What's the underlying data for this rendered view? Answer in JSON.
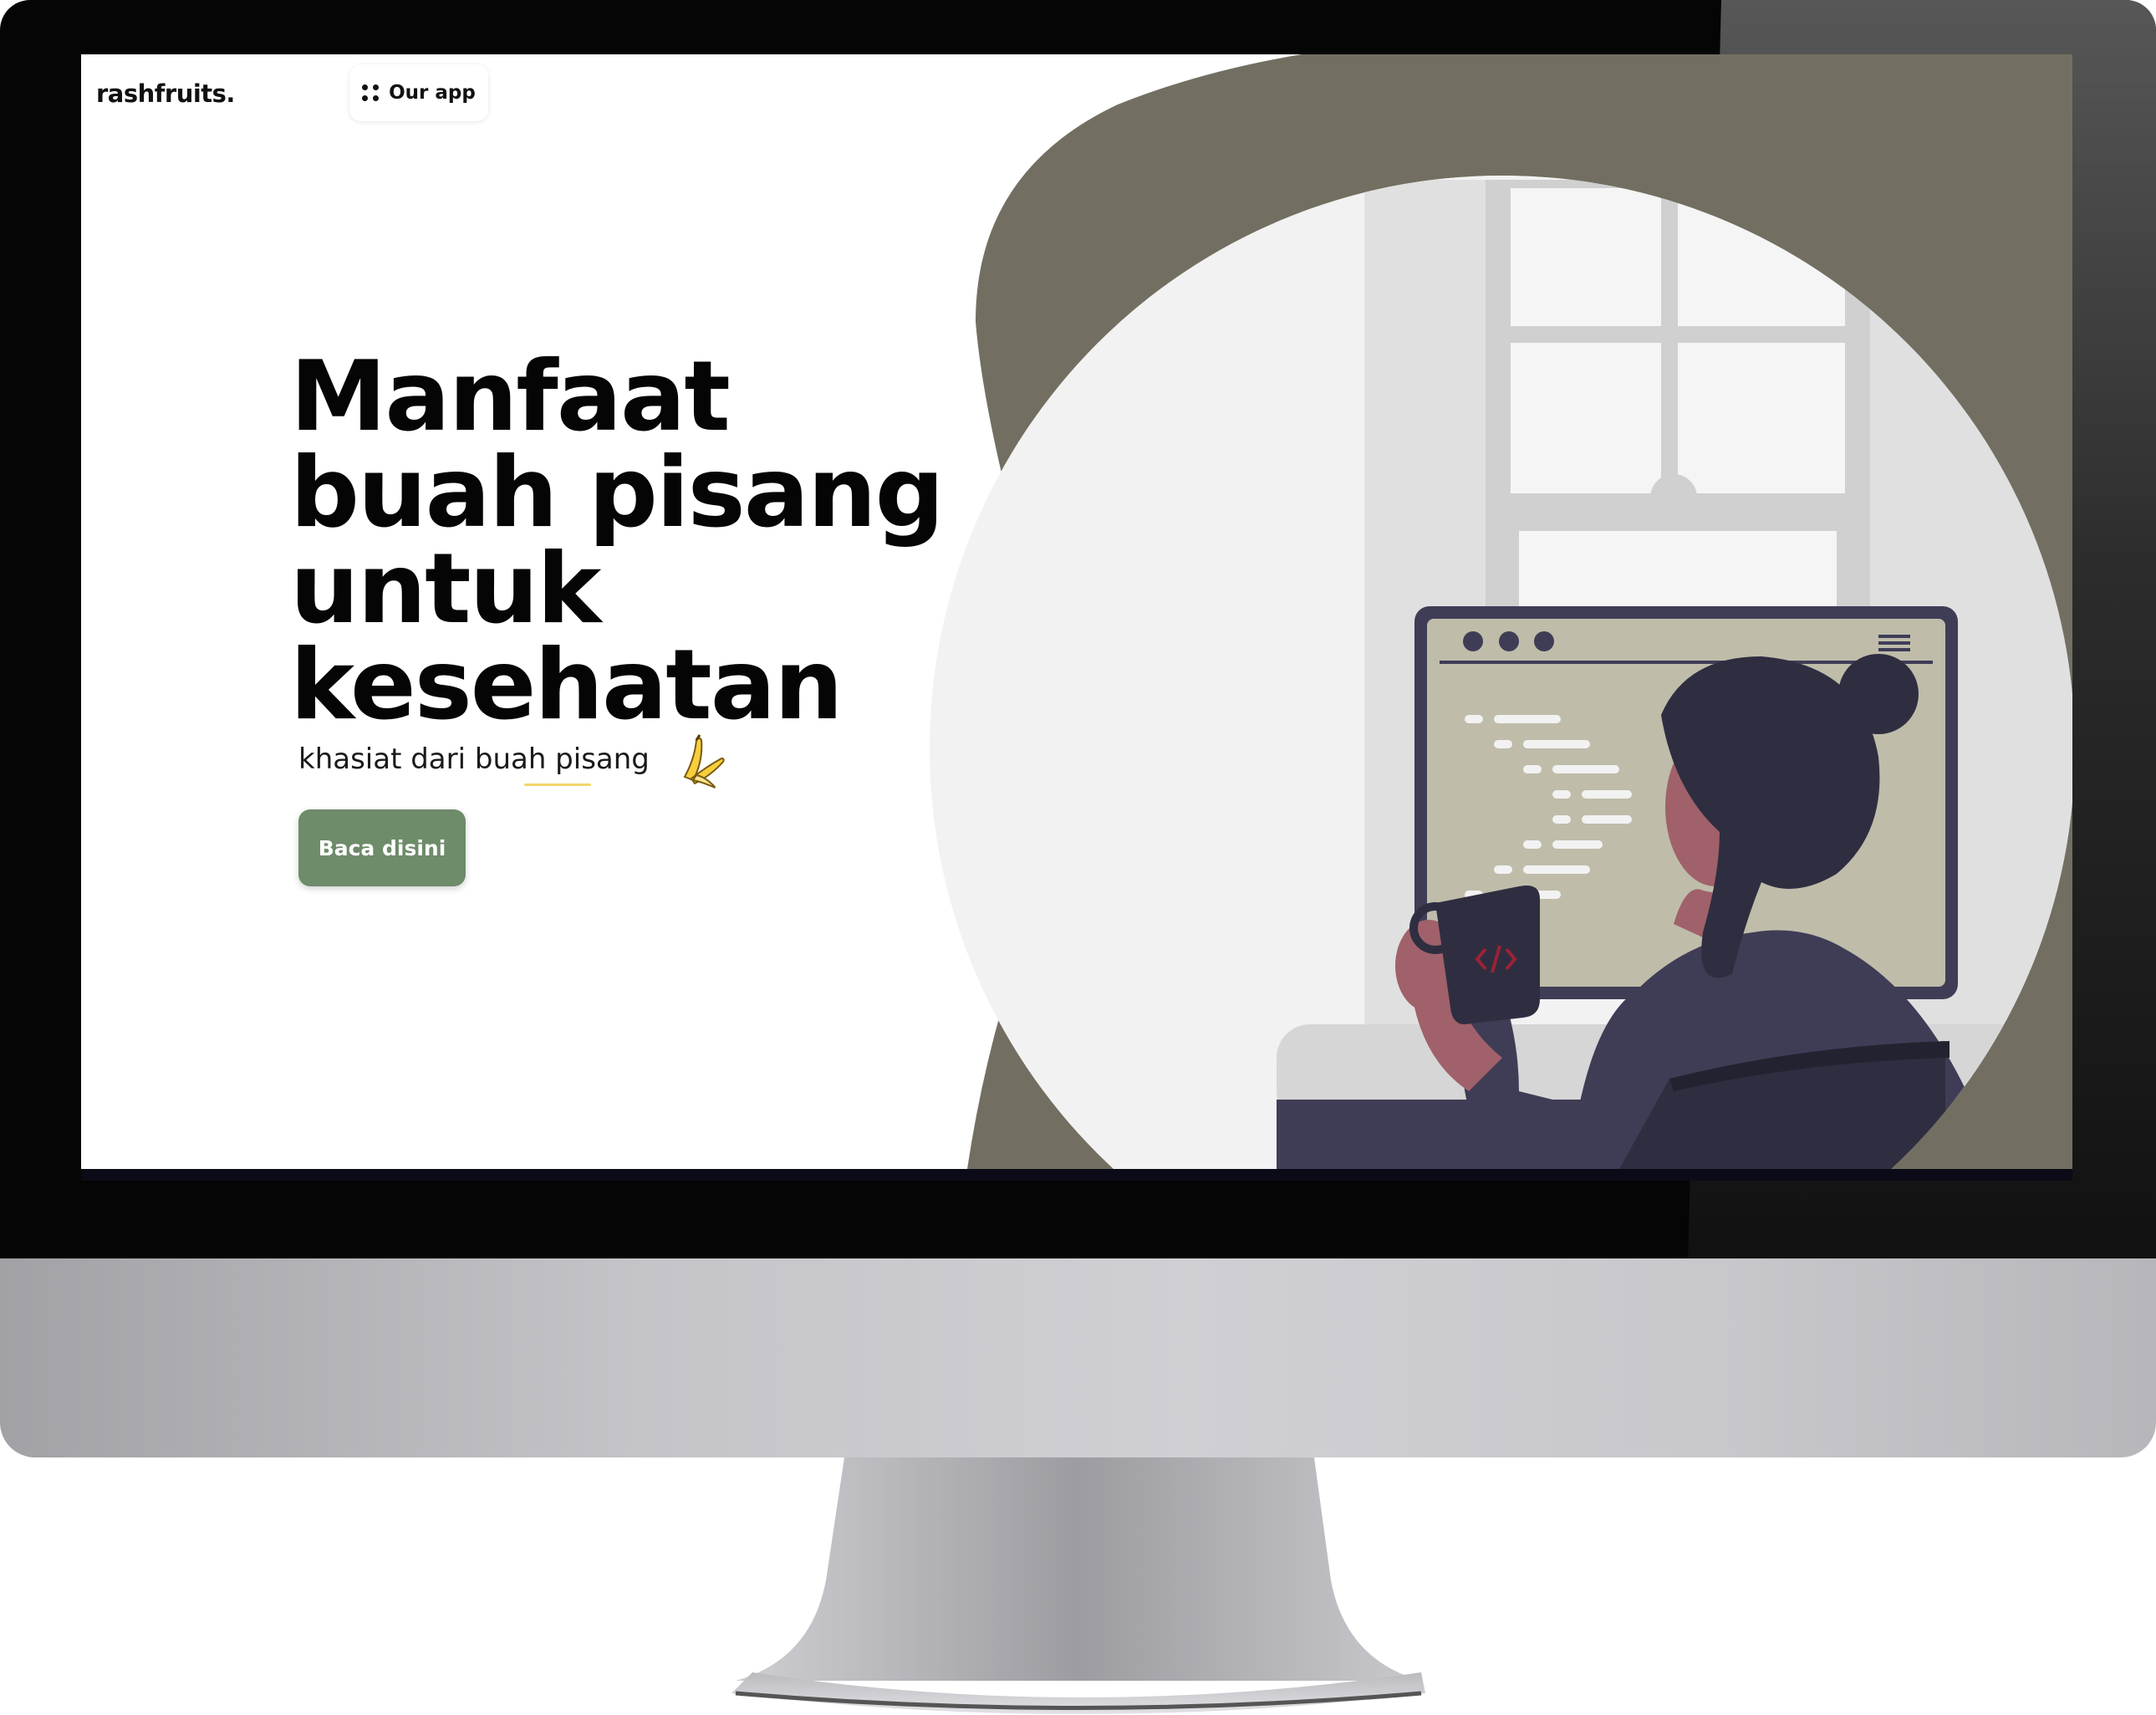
{
  "header": {
    "brand": "rashfruits.",
    "app_button_label": "Our app",
    "app_button_icon": "dots-grid-icon"
  },
  "hero": {
    "title_lines": [
      "Manfaat",
      "buah pisang",
      "untuk",
      "kesehatan"
    ],
    "subtitle": "khasiat dari buah pisang",
    "subtitle_icon": "banana-icon",
    "cta_label": "Baca disini"
  },
  "illustration": {
    "name": "woman-at-computer-illustration",
    "mug_icon": "code-tag-icon"
  },
  "colors": {
    "accent_green": "#6e8b6a",
    "blob_olive": "#726f62",
    "monitor_screen": "#bfbcaa",
    "clothing": "#3f3d56",
    "hair": "#2f2e41",
    "skin": "#a0616a"
  }
}
